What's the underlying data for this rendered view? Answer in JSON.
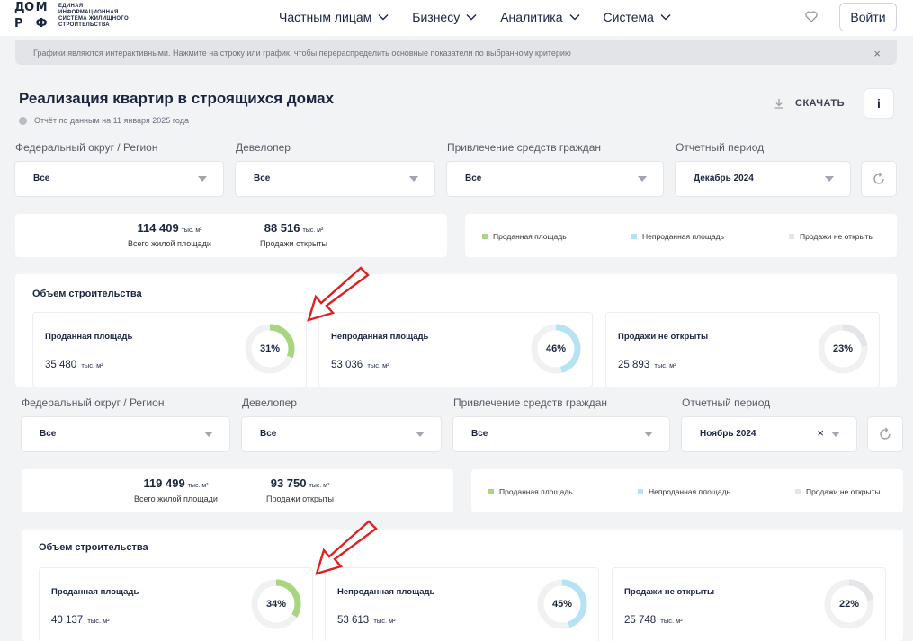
{
  "header": {
    "logo_mark": [
      "ДО",
      "М",
      "Р",
      "Ф"
    ],
    "logo_text": [
      "ЕДИНАЯ",
      "ИНФОРМАЦИОННАЯ",
      "СИСТЕМА ЖИЛИЩНОГО",
      "СТРОИТЕЛЬСТВА"
    ],
    "nav": [
      "Частным лицам",
      "Бизнесу",
      "Аналитика",
      "Система"
    ],
    "login_label": "Войти"
  },
  "banner": {
    "text": "Графики являются интерактивными. Нажмите на строку или график, чтобы перераспределить основные показатели по выбранному критерию",
    "close": "×"
  },
  "page": {
    "title": "Реализация квартир в строящихся домах",
    "report_date": "Отчёт по данным на 11 января 2025 года",
    "download_label": "СКАЧАТЬ",
    "info_label": "i"
  },
  "filter_labels": {
    "region": "Федеральный округ / Регион",
    "developer": "Девелопер",
    "funds": "Привлечение средств граждан",
    "period": "Отчетный период"
  },
  "snapshots": [
    {
      "filters": {
        "region": "Все",
        "developer": "Все",
        "funds": "Все",
        "period": "Декабрь 2024"
      },
      "totals": [
        {
          "value": "114 409",
          "unit": "тыс. м²",
          "label": "Всего жилой площади"
        },
        {
          "value": "88 516",
          "unit": "тыс. м²",
          "label": "Продажи открыты"
        }
      ],
      "kpis": [
        {
          "name": "Проданная площадь",
          "value": "35 480",
          "unit": "тыс. м²",
          "percent_label": "31%",
          "fraction": 0.31,
          "color": "#a8d57f"
        },
        {
          "name": "Непроданная площадь",
          "value": "53 036",
          "unit": "тыс. м²",
          "percent_label": "46%",
          "fraction": 0.46,
          "color": "#b6e3f3"
        },
        {
          "name": "Продажи не открыты",
          "value": "25 893",
          "unit": "тыс. м²",
          "percent_label": "23%",
          "fraction": 0.23,
          "color": "#e3e5e8"
        }
      ]
    },
    {
      "filters": {
        "region": "Все",
        "developer": "Все",
        "funds": "Все",
        "period": "Ноябрь 2024",
        "period_clear": "×"
      },
      "totals": [
        {
          "value": "119 499",
          "unit": "тыс. м²",
          "label": "Всего жилой площади"
        },
        {
          "value": "93 750",
          "unit": "тыс. м²",
          "label": "Продажи открыты"
        }
      ],
      "kpis": [
        {
          "name": "Проданная площадь",
          "value": "40 137",
          "unit": "тыс. м²",
          "percent_label": "34%",
          "fraction": 0.34,
          "color": "#a8d57f"
        },
        {
          "name": "Непроданная площадь",
          "value": "53 613",
          "unit": "тыс. м²",
          "percent_label": "45%",
          "fraction": 0.45,
          "color": "#b6e3f3"
        },
        {
          "name": "Продажи не открыты",
          "value": "25 748",
          "unit": "тыс. м²",
          "percent_label": "22%",
          "fraction": 0.22,
          "color": "#e3e5e8"
        }
      ]
    }
  ],
  "legend": [
    {
      "label": "Проданная площадь",
      "color": "#a8d57f"
    },
    {
      "label": "Непроданная площадь",
      "color": "#b6e3f3"
    },
    {
      "label": "Продажи не открыты",
      "color": "#e3e5e8"
    }
  ],
  "section_title": "Объем строительства",
  "colors": {
    "donut_track": "#f0f1f3",
    "annotation_arrow": "#e02020",
    "brand_text": "#1a2540"
  }
}
